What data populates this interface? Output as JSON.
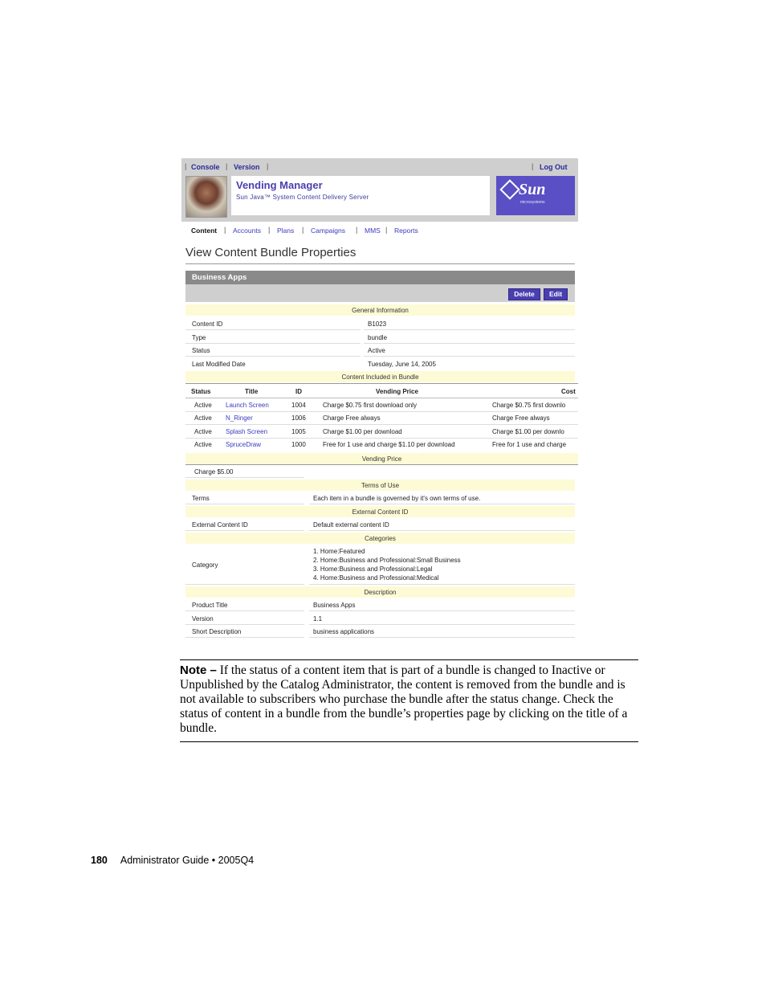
{
  "utility_bar": {
    "console": "Console",
    "version": "Version",
    "logout": "Log Out"
  },
  "banner": {
    "title": "Vending Manager",
    "subtitle": "Sun Java™ System Content Delivery Server",
    "logo": "Sun",
    "logo_tag": "microsystems"
  },
  "nav": [
    "Content",
    "Accounts",
    "Plans",
    "Campaigns",
    "MMS",
    "Reports"
  ],
  "page_title": "View Content Bundle Properties",
  "section_title": "Business Apps",
  "buttons": {
    "delete": "Delete",
    "edit": "Edit"
  },
  "general": {
    "header": "General Information",
    "rows": [
      {
        "k": "Content ID",
        "v": "B1023"
      },
      {
        "k": "Type",
        "v": "bundle"
      },
      {
        "k": "Status",
        "v": "Active"
      },
      {
        "k": "Last Modified Date",
        "v": "Tuesday, June 14, 2005"
      }
    ]
  },
  "included": {
    "header": "Content Included in Bundle",
    "columns": [
      "Status",
      "Title",
      "ID",
      "Vending Price",
      "Cost"
    ],
    "rows": [
      {
        "status": "Active",
        "title": "Launch Screen",
        "id": "1004",
        "price": "Charge $0.75 first download only",
        "cost": "Charge $0.75 first downlo"
      },
      {
        "status": "Active",
        "title": "N_Ringer",
        "id": "1006",
        "price": "Charge Free always",
        "cost": "Charge Free always"
      },
      {
        "status": "Active",
        "title": "Splash Screen",
        "id": "1005",
        "price": "Charge $1.00 per download",
        "cost": "Charge $1.00 per downlo"
      },
      {
        "status": "Active",
        "title": "SpruceDraw",
        "id": "1000",
        "price": "Free for 1 use and charge $1.10 per download",
        "cost": "Free for 1 use and charge"
      }
    ]
  },
  "vending": {
    "header": "Vending Price",
    "value": "Charge $5.00"
  },
  "terms": {
    "header": "Terms of Use",
    "k": "Terms",
    "v": "Each item in a bundle is governed by it's own terms of use."
  },
  "external": {
    "header": "External Content ID",
    "k": "External Content ID",
    "v": "Default external content ID"
  },
  "categories": {
    "header": "Categories",
    "k": "Category",
    "items": [
      "1. Home:Featured",
      "2. Home:Business and Professional:Small Business",
      "3. Home:Business and Professional:Legal",
      "4. Home:Business and Professional:Medical"
    ]
  },
  "description": {
    "header": "Description",
    "rows": [
      {
        "k": "Product Title",
        "v": "Business Apps"
      },
      {
        "k": "Version",
        "v": "1.1"
      },
      {
        "k": "Short Description",
        "v": "business applications"
      }
    ]
  },
  "note": {
    "label": "Note –",
    "text": "If the status of a content item that is part of a bundle is changed to Inactive or Unpublished by the Catalog Administrator, the content is removed from the bundle and is not available to subscribers who purchase the bundle after the status change. Check the status of content in a bundle from the bundle’s properties page by clicking on the title of a bundle."
  },
  "footer": {
    "page": "180",
    "text": "Administrator Guide • 2005Q4"
  }
}
